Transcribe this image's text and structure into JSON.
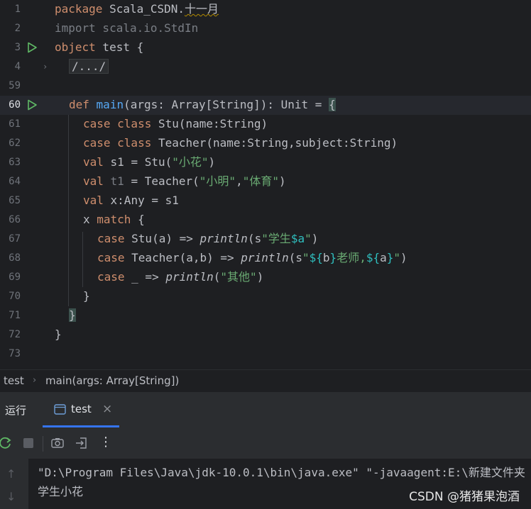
{
  "editor": {
    "lines": {
      "n1": "1",
      "n2": "2",
      "n3": "3",
      "n4": "4",
      "n59": "59",
      "n60": "60",
      "n61": "61",
      "n62": "62",
      "n63": "63",
      "n64": "64",
      "n65": "65",
      "n66": "66",
      "n67": "67",
      "n68": "68",
      "n69": "69",
      "n70": "70",
      "n71": "71",
      "n72": "72",
      "n73": "73"
    },
    "code": {
      "l1_kw": "package",
      "l1_pkg": " Scala_CSDN.",
      "l1_pkg2": "十一月",
      "l2": "import scala.io.StdIn",
      "l3_kw": "object",
      "l3_rest": " test {",
      "l4_fold": "/.../",
      "l60_def": "def",
      "l60_main": "main",
      "l60_rest": "(args: Array[String]): Unit = ",
      "l60_brace": "{",
      "l61_kw": "case class",
      "l61_rest": " Stu(name:String)",
      "l62_kw": "case class",
      "l62_rest": " Teacher(name:String,subject:String)",
      "l63_kw": "val",
      "l63_a": " s1 = Stu(",
      "l63_s": "\"小花\"",
      "l63_b": ")",
      "l64_kw": "val",
      "l64_t1": " t1",
      "l64_a": " = Teacher(",
      "l64_s1": "\"小明\"",
      "l64_c": ",",
      "l64_s2": "\"体育\"",
      "l64_b": ")",
      "l65_kw": "val",
      "l65_rest": " x:Any = s1",
      "l66_a": "x ",
      "l66_kw": "match",
      "l66_b": " {",
      "l67_kw": "case",
      "l67_a": " Stu(a) => ",
      "l67_fn": "println",
      "l67_b": "(s",
      "l67_s1": "\"学生",
      "l67_tpl": "$a",
      "l67_s2": "\"",
      "l67_c": ")",
      "l68_kw": "case",
      "l68_a": " Teacher(a,b) => ",
      "l68_fn": "println",
      "l68_b": "(s",
      "l68_s1": "\"",
      "l68_tpl1": "${",
      "l68_v1": "b",
      "l68_tpl1e": "}",
      "l68_s2": "老师,",
      "l68_tpl2": "${",
      "l68_v2": "a",
      "l68_tpl2e": "}",
      "l68_s3": "\"",
      "l68_c": ")",
      "l69_kw": "case",
      "l69_a": " _ => ",
      "l69_fn": "println",
      "l69_b": "(",
      "l69_s": "\"其他\"",
      "l69_c": ")",
      "l70": "}",
      "l71": "}",
      "l72": "}"
    }
  },
  "breadcrumb": {
    "item1": "test",
    "sep": "›",
    "item2": "main(args: Array[String])"
  },
  "run_panel": {
    "title": "运行",
    "tab_label": "test",
    "tab_close": "×"
  },
  "console": {
    "line1": "\"D:\\Program Files\\Java\\jdk-10.0.1\\bin\\java.exe\" \"-javaagent:E:\\新建文件夹",
    "line2": "学生小花"
  },
  "watermark": "CSDN @猪猪果泡酒",
  "colors": {
    "accent": "#3574f0",
    "run_green": "#5fb865",
    "keyword": "#cf8e6d",
    "string": "#6aab73",
    "function": "#56a8f5"
  },
  "icons": [
    "run-gutter-icon",
    "fold-chevron-icon",
    "console-tab-icon",
    "close-icon",
    "rerun-icon",
    "stop-icon",
    "camera-icon",
    "exit-icon",
    "more-icon",
    "scroll-up-icon",
    "scroll-down-icon"
  ]
}
